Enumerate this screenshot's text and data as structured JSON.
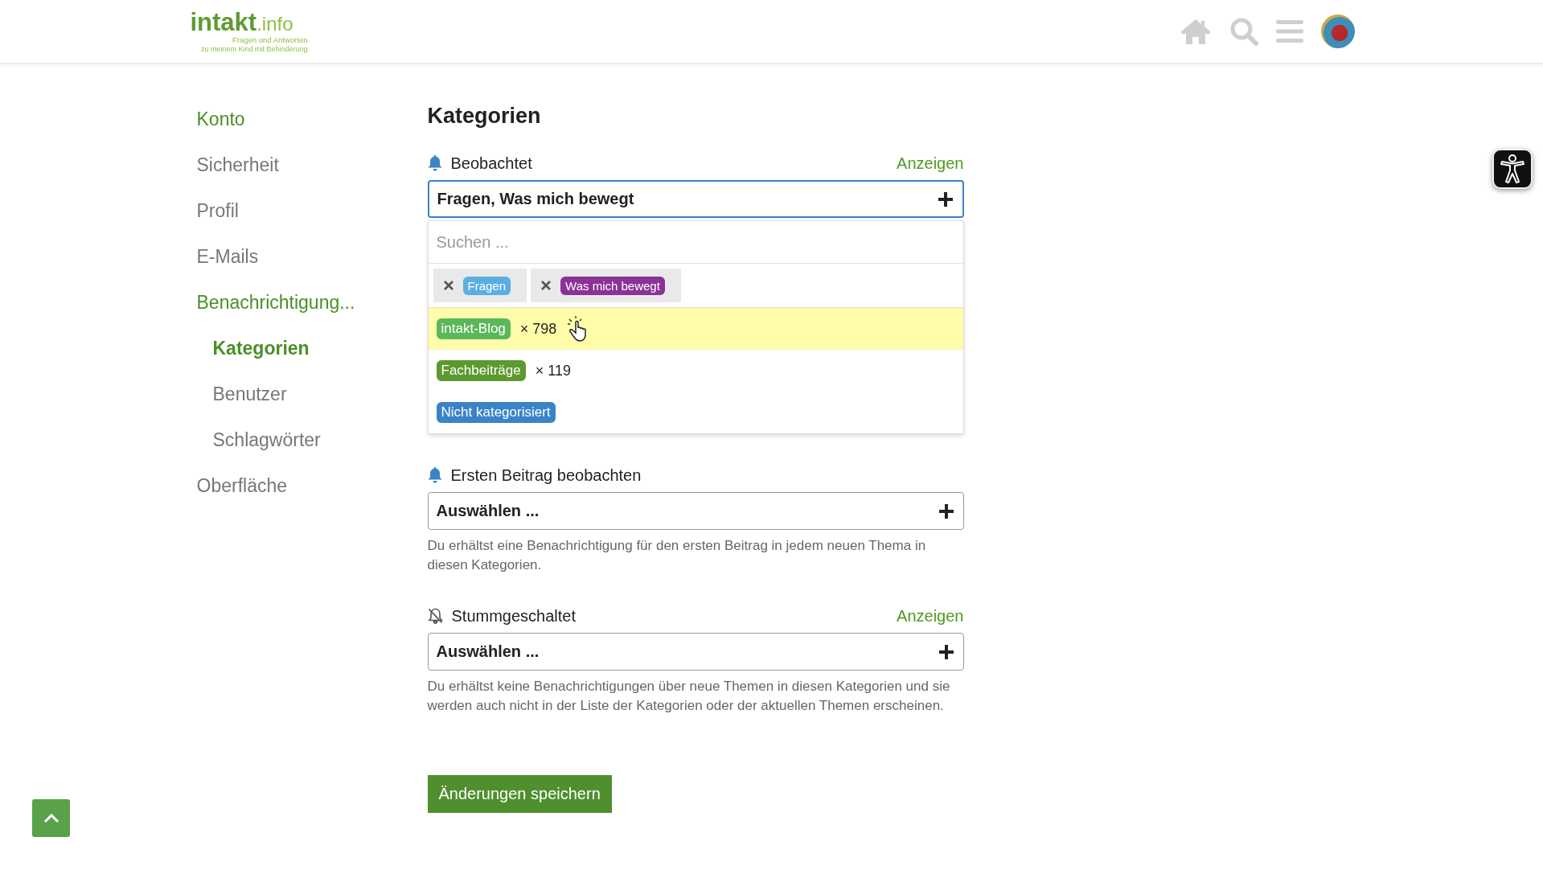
{
  "header": {
    "logo": {
      "main": "intakt",
      "suffix": ".info",
      "tagline_1": "Fragen und Antworten",
      "tagline_2": "zu meinem Kind mit Behinderung"
    }
  },
  "sidebar": {
    "items": [
      {
        "label": "Konto",
        "active": true
      },
      {
        "label": "Sicherheit",
        "active": false
      },
      {
        "label": "Profil",
        "active": false
      },
      {
        "label": "E-Mails",
        "active": false
      },
      {
        "label": "Benachrichtigung...",
        "active": true,
        "children": [
          {
            "label": "Kategorien",
            "selected": true
          },
          {
            "label": "Benutzer",
            "selected": false
          },
          {
            "label": "Schlagwörter",
            "selected": false
          }
        ]
      },
      {
        "label": "Oberfläche",
        "active": false
      }
    ]
  },
  "page_title": "Kategorien",
  "sections": [
    {
      "kind": "watching",
      "label": "Beobachtet",
      "link": "Anzeigen",
      "value": "Fragen, Was mich bewegt",
      "open": true,
      "dropdown": {
        "placeholder": "Suchen ...",
        "chosen": [
          {
            "name": "Fragen",
            "color": "#5aaee2"
          },
          {
            "name": "Was mich bewegt",
            "color": "#8b3296"
          }
        ],
        "options": [
          {
            "name": "intakt-Blog",
            "color": "#5bb85a",
            "count": "× 798",
            "highlighted": true
          },
          {
            "name": "Fachbeiträge",
            "color": "#5c992f",
            "count": "× 119",
            "highlighted": false
          },
          {
            "name": "Nicht kategorisiert",
            "color": "#3a83c8",
            "highlighted": false
          }
        ]
      }
    },
    {
      "kind": "watching",
      "label": "Ersten Beitrag beobachten",
      "value": "Auswählen ...",
      "open": false,
      "description": "Du erhältst eine Benachrichtigung für den ersten Beitrag in jedem neuen Thema in diesen Kategorien."
    },
    {
      "kind": "muted",
      "label": "Stummgeschaltet",
      "link": "Anzeigen",
      "value": "Auswählen ...",
      "open": false,
      "description": "Du erhältst keine Benachrichtigungen über neue Themen in diesen Kategorien und sie werden auch nicht in der Liste der Kategorien oder der aktuellen Themen erscheinen."
    }
  ],
  "save_button": "Änderungen speichern"
}
